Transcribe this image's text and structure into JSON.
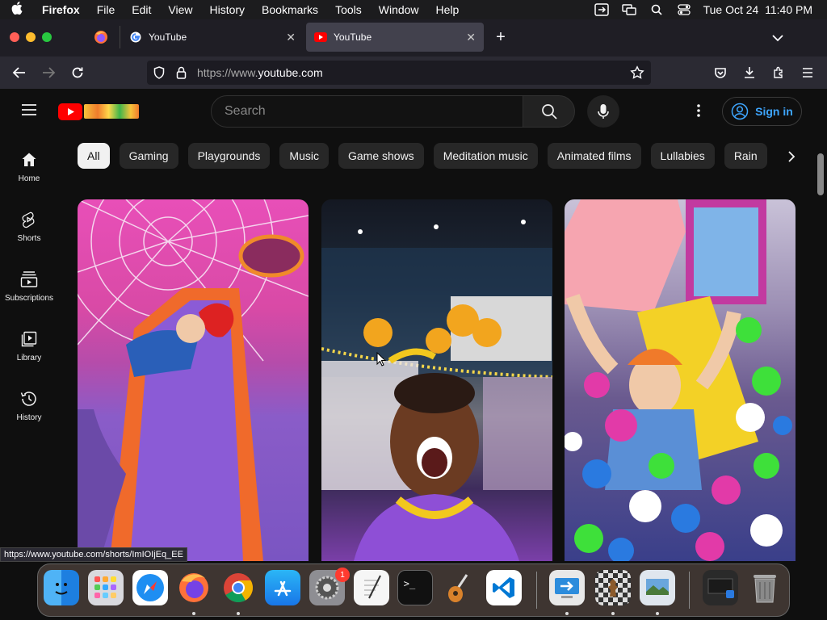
{
  "menubar": {
    "app": "Firefox",
    "items": [
      "File",
      "Edit",
      "View",
      "History",
      "Bookmarks",
      "Tools",
      "Window",
      "Help"
    ],
    "clock": "Tue Oct 24  11:40 PM"
  },
  "tabs": [
    {
      "title": "YouTube",
      "active": false
    },
    {
      "title": "YouTube",
      "active": true
    }
  ],
  "urlbar": {
    "prefix": "https://www.",
    "host": "youtube.com"
  },
  "youtube": {
    "search_placeholder": "Search",
    "sign_in": "Sign in",
    "sidebar": [
      {
        "label": "Home",
        "icon": "home-icon"
      },
      {
        "label": "Shorts",
        "icon": "shorts-icon"
      },
      {
        "label": "Subscriptions",
        "icon": "subscriptions-icon"
      },
      {
        "label": "Library",
        "icon": "library-icon"
      },
      {
        "label": "History",
        "icon": "history-icon"
      }
    ],
    "chips": [
      "All",
      "Gaming",
      "Playgrounds",
      "Music",
      "Game shows",
      "Meditation music",
      "Animated films",
      "Lullabies",
      "Rain"
    ]
  },
  "status_url": "https://www.youtube.com/shorts/ImIOIjEq_EE",
  "dock": {
    "apps": [
      "finder-icon",
      "launchpad-icon",
      "safari-icon",
      "firefox-icon",
      "chrome-icon",
      "app-store-icon",
      "system-settings-icon",
      "textedit-icon",
      "terminal-icon",
      "garageband-icon",
      "vscode-icon",
      "remote-desktop-icon",
      "chess-icon",
      "preview-icon",
      "screenshot-icon",
      "trash-icon"
    ],
    "settings_badge": "1"
  },
  "colors": {
    "youtube_red": "#ff0000",
    "link_blue": "#3ea6ff",
    "firefox_tab_active": "#42414d"
  }
}
